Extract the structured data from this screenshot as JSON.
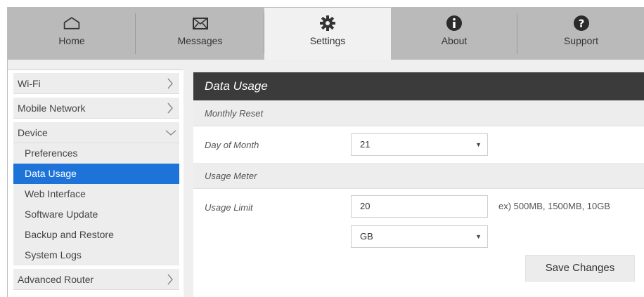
{
  "nav": {
    "tabs": [
      {
        "label": "Home",
        "icon": "home-icon",
        "active": false
      },
      {
        "label": "Messages",
        "icon": "envelope-icon",
        "active": false
      },
      {
        "label": "Settings",
        "icon": "gear-icon",
        "active": true
      },
      {
        "label": "About",
        "icon": "info-icon",
        "active": false
      },
      {
        "label": "Support",
        "icon": "question-icon",
        "active": false
      }
    ]
  },
  "sidebar": {
    "items": [
      {
        "label": "Wi-Fi",
        "expanded": false
      },
      {
        "label": "Mobile Network",
        "expanded": false
      },
      {
        "label": "Device",
        "expanded": true
      },
      {
        "label": "Advanced Router",
        "expanded": false
      }
    ],
    "device_subitems": [
      {
        "label": "Preferences",
        "active": false
      },
      {
        "label": "Data Usage",
        "active": true
      },
      {
        "label": "Web Interface",
        "active": false
      },
      {
        "label": "Software Update",
        "active": false
      },
      {
        "label": "Backup and Restore",
        "active": false
      },
      {
        "label": "System Logs",
        "active": false
      }
    ]
  },
  "main": {
    "title": "Data Usage",
    "monthly_reset": {
      "section_label": "Monthly Reset",
      "day_label": "Day of Month",
      "day_value": "21"
    },
    "usage_meter": {
      "section_label": "Usage Meter",
      "limit_label": "Usage Limit",
      "limit_value": "20",
      "limit_hint": "ex) 500MB, 1500MB, 10GB",
      "unit_value": "GB"
    },
    "save_label": "Save Changes"
  },
  "colors": {
    "active_blue": "#1e73d9",
    "header_dark": "#3b3b3b",
    "nav_gray": "#bababa"
  }
}
